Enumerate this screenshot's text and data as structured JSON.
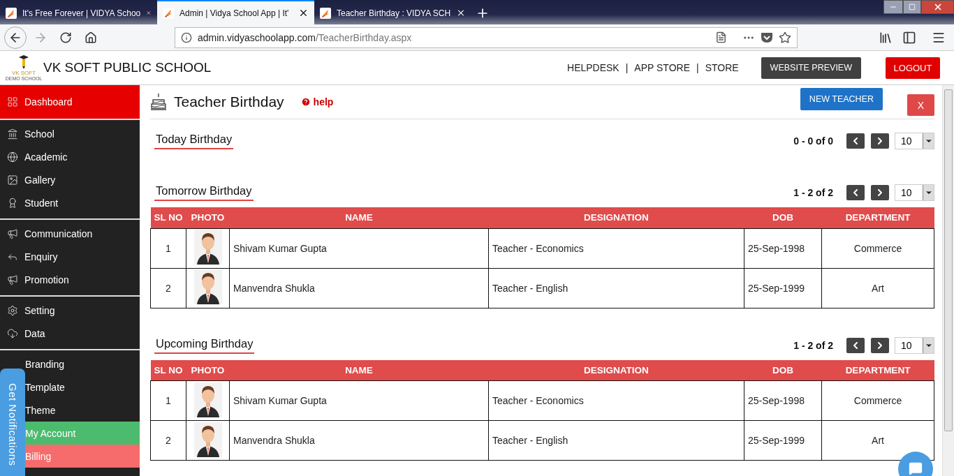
{
  "browser": {
    "tabs": [
      {
        "title": "It's Free Forever | VIDYA Schoo",
        "selected": false
      },
      {
        "title": "Admin | Vidya School App | It'",
        "selected": true
      },
      {
        "title": "Teacher Birthday : VIDYA SCH",
        "selected": false
      }
    ],
    "url": {
      "host": "admin.vidyaschoolapp.com",
      "path": "/TeacherBirthday.aspx"
    }
  },
  "header": {
    "logo_text": "VK SOFT",
    "logo_subtext": "DEMO SCHOOL",
    "school_name": "VK SOFT PUBLIC SCHOOL",
    "links": [
      "HELPDESK",
      "APP STORE",
      "STORE"
    ],
    "separator": "|",
    "preview_button": "WEBSITE PREVIEW",
    "logout_button": "LOGOUT"
  },
  "sidebar": {
    "groups": [
      {
        "items": [
          {
            "label": "Dashboard",
            "selected": true
          }
        ]
      },
      {
        "items": [
          {
            "label": "School",
            "selected": false
          },
          {
            "label": "Academic",
            "selected": false
          },
          {
            "label": "Gallery",
            "selected": false
          },
          {
            "label": "Student",
            "selected": false
          }
        ]
      },
      {
        "items": [
          {
            "label": "Communication",
            "selected": false
          },
          {
            "label": "Enquiry",
            "selected": false
          },
          {
            "label": "Promotion",
            "selected": false
          }
        ]
      },
      {
        "items": [
          {
            "label": "Setting",
            "selected": false
          },
          {
            "label": "Data",
            "selected": false
          }
        ]
      },
      {
        "items": [
          {
            "label": "Branding",
            "selected": false
          },
          {
            "label": "Template",
            "selected": false
          },
          {
            "label": "Theme",
            "selected": false
          },
          {
            "label": "My Account",
            "selected": false,
            "color": "#4cbb6e"
          },
          {
            "label": "Billing",
            "selected": false,
            "color": "#f66b6b"
          }
        ]
      }
    ]
  },
  "page": {
    "title": "Teacher Birthday",
    "help": "help",
    "new_button": "NEW TEACHER",
    "close_button": "X"
  },
  "sections": [
    {
      "title": "Today Birthday",
      "range": "0 - 0 of 0",
      "per_page": "10"
    },
    {
      "title": "Tomorrow Birthday",
      "range": "1 - 2 of 2",
      "per_page": "10",
      "table": {
        "columns": [
          "SL NO",
          "PHOTO",
          "NAME",
          "DESIGNATION",
          "DOB",
          "DEPARTMENT"
        ],
        "rows": [
          {
            "sl_no": "1",
            "name": "Shivam Kumar Gupta",
            "designation": "Teacher - Economics",
            "dob": "25-Sep-1998",
            "department": "Commerce"
          },
          {
            "sl_no": "2",
            "name": "Manvendra Shukla",
            "designation": "Teacher - English",
            "dob": "25-Sep-1999",
            "department": "Art"
          }
        ]
      }
    },
    {
      "title": "Upcoming Birthday",
      "range": "1 - 2 of 2",
      "per_page": "10",
      "table": {
        "columns": [
          "SL NO",
          "PHOTO",
          "NAME",
          "DESIGNATION",
          "DOB",
          "DEPARTMENT"
        ],
        "rows": [
          {
            "sl_no": "1",
            "name": "Shivam Kumar Gupta",
            "designation": "Teacher - Economics",
            "dob": "25-Sep-1998",
            "department": "Commerce"
          },
          {
            "sl_no": "2",
            "name": "Manvendra Shukla",
            "designation": "Teacher - English",
            "dob": "25-Sep-1999",
            "department": "Art"
          }
        ]
      }
    }
  ],
  "notifications": {
    "label": "Get Notifications"
  }
}
